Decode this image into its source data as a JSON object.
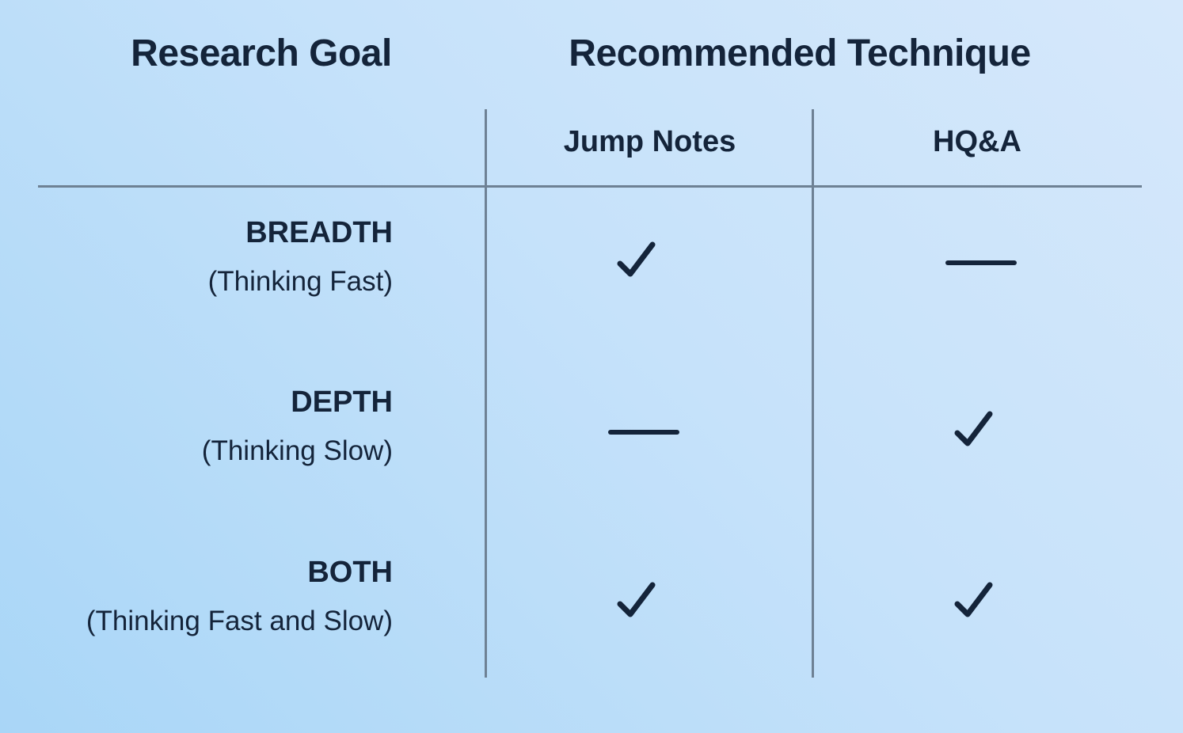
{
  "headers": {
    "goal": "Research Goal",
    "technique": "Recommended Technique"
  },
  "columns": [
    "Jump Notes",
    "HQ&A"
  ],
  "rows": [
    {
      "title": "BREADTH",
      "subtitle": "(Thinking Fast)",
      "marks": [
        "check",
        "dash"
      ]
    },
    {
      "title": "DEPTH",
      "subtitle": "(Thinking Slow)",
      "marks": [
        "dash",
        "check"
      ]
    },
    {
      "title": "BOTH",
      "subtitle": "(Thinking Fast and Slow)",
      "marks": [
        "check",
        "check"
      ]
    }
  ],
  "icons": {
    "check": "check-icon",
    "dash": "dash-icon"
  },
  "colors": {
    "text": "#14243a",
    "rule": "#6e8194",
    "background_light": "#d6e8fb",
    "background_dark": "#a9d6f7"
  }
}
